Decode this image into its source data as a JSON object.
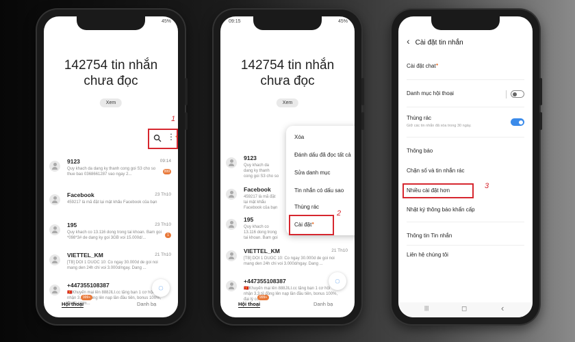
{
  "phone1": {
    "status_time": "",
    "status_battery": "45%",
    "unread_title": "142754 tin nhắn chưa đọc",
    "view_button": "Xem",
    "step_number": "1",
    "messages": [
      {
        "name": "9123",
        "date": "09:14",
        "snippet": "Quy khach da dang ky thanh cong goi S3 cho so thue bao 0368661287 vao ngay 2...",
        "badge": "999"
      },
      {
        "name": "Facebook",
        "date": "23 Th10",
        "snippet": "459217 là mã đặt lại mật khẩu Facebook của bạn",
        "badge": ""
      },
      {
        "name": "195",
        "date": "23 Th10",
        "snippet": "Quy khach co 13.116 dong trong tai khoan. Bam goi *098*3# de dang ky goi 3GB voi 15.000d/...",
        "badge": "1"
      },
      {
        "name": "VIETTEL_KM",
        "date": "21 Th10",
        "snippet": "[TB] DOI 1 DUOC 10: Co ngay 30.000d de goi noi mang den 24h chi voi 3.000d/ngay. Dang ...",
        "badge": ""
      },
      {
        "name": "+447355108387",
        "date": "",
        "snippet": "🇻🇳Khuyến mại lên 888JILI.cc tặng bạn 1 cơ hội nhận 3,3 tỷ đồng lên nạp lần đầu tiên, bonus 100%, đại lý có m...",
        "badge": ""
      }
    ],
    "tab_conversations": "Hội thoại",
    "tab_contacts": "Danh bạ",
    "tab_badge": "999+"
  },
  "phone2": {
    "status_time": "09:15",
    "status_battery": "45%",
    "unread_title": "142754 tin nhắn chưa đọc",
    "view_button": "Xem",
    "step_number": "2",
    "menu": [
      {
        "label": "Xóa",
        "dot": false
      },
      {
        "label": "Đánh dấu đã đọc tất cả",
        "dot": false
      },
      {
        "label": "Sửa danh mục",
        "dot": false
      },
      {
        "label": "Tin nhắn có dấu sao",
        "dot": false
      },
      {
        "label": "Thùng rác",
        "dot": false
      },
      {
        "label": "Cài đặt",
        "dot": true
      }
    ],
    "messages": [
      {
        "name": "9123",
        "date": "",
        "snippet": "Quy khach da dang ky thanh cong goi S3 cho so thue bao 0368661287 vao...",
        "badge": ""
      },
      {
        "name": "Facebook",
        "date": "",
        "snippet": "459217 là mã đặt lại mật khẩu Facebook của bạn",
        "badge": ""
      },
      {
        "name": "195",
        "date": "",
        "snippet": "Quy khach co 13.116 dong trong tai khoan. Bam goi *098*...",
        "badge": ""
      },
      {
        "name": "VIETTEL_KM",
        "date": "21 Th10",
        "snippet": "[TB] DOI 1 DUOC 10: Co ngay 30.000d de goi noi mang den 24h chi voi 3.000d/ngay. Dang ...",
        "badge": ""
      },
      {
        "name": "+447355108387",
        "date": "",
        "snippet": "🇻🇳Khuyến mại lên 888JILI.cc tặng bạn 1 cơ hội nhận 3,3 tỷ đồng lên nạp lần đầu tiên, bonus 100%, đại lý có m...",
        "badge": ""
      }
    ],
    "tab_conversations": "Hội thoại",
    "tab_contacts": "Danh bạ",
    "tab_badge": "999+"
  },
  "phone3": {
    "header_title": "Cài đặt tin nhắn",
    "step_number": "3",
    "chat_settings": "Cài đặt chat",
    "conversation_categories": "Danh mục hội thoại",
    "trash": "Thùng rác",
    "trash_sub": "Giữ các tin nhắn đã xóa trong 30 ngày.",
    "notifications": "Thông báo",
    "block_spam": "Chặn số và tin nhắn rác",
    "more_settings": "Nhiều cài đặt hơn",
    "emergency_log": "Nhật ký thông báo khẩn cấp",
    "about_messages": "Thông tin Tin nhắn",
    "contact_us": "Liên hệ chúng tôi",
    "nav_recent": "|||",
    "nav_home": "◻",
    "nav_back": "‹"
  },
  "colors": {
    "highlight": "#d6262e",
    "badge": "#e8793a",
    "toggle_on": "#3b8bea"
  }
}
